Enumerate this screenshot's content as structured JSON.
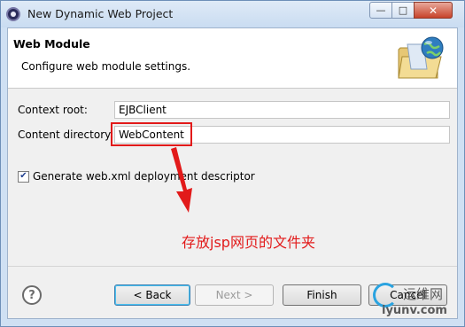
{
  "window": {
    "title": "New Dynamic Web Project",
    "controls": {
      "minimize_glyph": "—",
      "maximize_glyph": "□",
      "close_glyph": "✕"
    }
  },
  "banner": {
    "title": "Web Module",
    "subtitle": "Configure web module settings.",
    "icon": "folder-globe-icon"
  },
  "form": {
    "context_root": {
      "label": "Context root:",
      "value": "EJBClient"
    },
    "content_directory": {
      "label": "Content directory:",
      "value": "WebContent"
    },
    "generate_descriptor": {
      "label": "Generate web.xml deployment descriptor",
      "checked": true,
      "glyph": "✔"
    }
  },
  "annotation": {
    "text": "存放jsp网页的文件夹",
    "color": "#e21a1a"
  },
  "footer": {
    "help_glyph": "?",
    "back_label": "< Back",
    "next_label": "Next >",
    "finish_label": "Finish",
    "cancel_label": "Cancel"
  },
  "watermark": {
    "cn_text": "运维网",
    "url": "iyunv.com"
  }
}
